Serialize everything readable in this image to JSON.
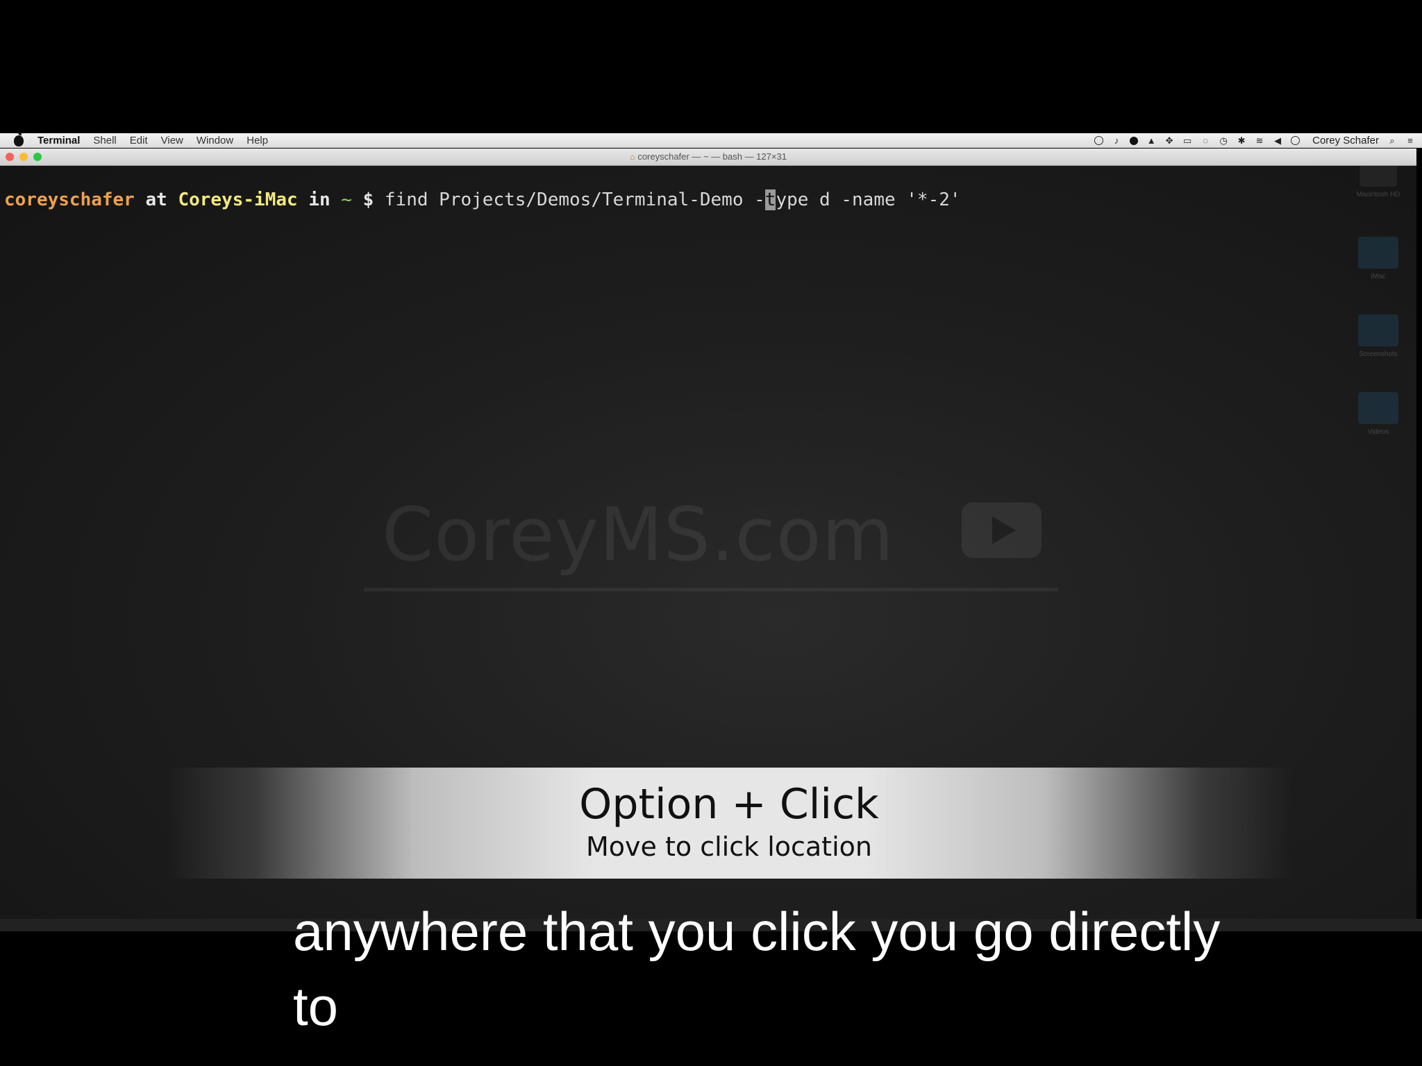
{
  "menubar": {
    "app_name": "Terminal",
    "items": [
      "Shell",
      "Edit",
      "View",
      "Window",
      "Help"
    ],
    "user": "Corey Schafer"
  },
  "window": {
    "title": "coreyschafer — ~ — bash — 127×31"
  },
  "terminal": {
    "prompt_user": "coreyschafer",
    "prompt_at": "at",
    "prompt_host": "Coreys-iMac",
    "prompt_in": "in",
    "prompt_dir": "~",
    "prompt_symbol": "$",
    "command_before_cursor": "find Projects/Demos/Terminal-Demo -",
    "cursor_char": "t",
    "command_after_cursor": "ype d -name '*-2'"
  },
  "watermark": {
    "text": "CoreyMS.com"
  },
  "desktop": {
    "items": [
      "Macintosh HD",
      "iMac",
      "Screenshots",
      "Videos"
    ]
  },
  "banner": {
    "title": "Option + Click",
    "subtitle": "Move to click location"
  },
  "caption": {
    "line1": "anywhere that you click you go directly",
    "line2": "to"
  }
}
